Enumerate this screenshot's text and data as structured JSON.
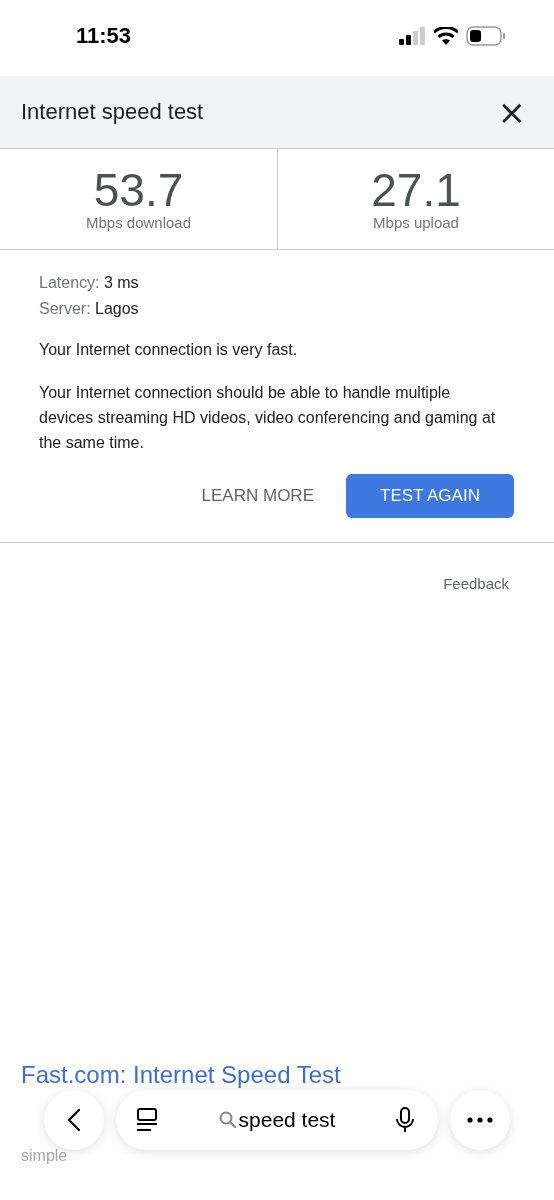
{
  "status_bar": {
    "time": "11:53"
  },
  "header": {
    "title": "Internet speed test",
    "close_label": "×"
  },
  "results": [
    {
      "value": "53.7",
      "unit": "Mbps download"
    },
    {
      "value": "27.1",
      "unit": "Mbps upload"
    }
  ],
  "details": [
    {
      "label": "Latency:",
      "value": "3 ms"
    },
    {
      "label": "Server:",
      "value": "Lagos"
    }
  ],
  "summary": "Your Internet connection is very fast.",
  "description": "Your Internet connection should be able to handle multiple devices streaming HD videos, video conferencing and gaming at the same time.",
  "buttons": [
    {
      "label": "LEARN MORE",
      "kind": "text"
    },
    {
      "label": "TEST AGAIN",
      "kind": "primary"
    }
  ],
  "feedback": "Feedback",
  "search_result": {
    "title": "Fast.com: Internet Speed Test",
    "snippet_line": "simple"
  },
  "toolbar": {
    "query": "speed test"
  }
}
